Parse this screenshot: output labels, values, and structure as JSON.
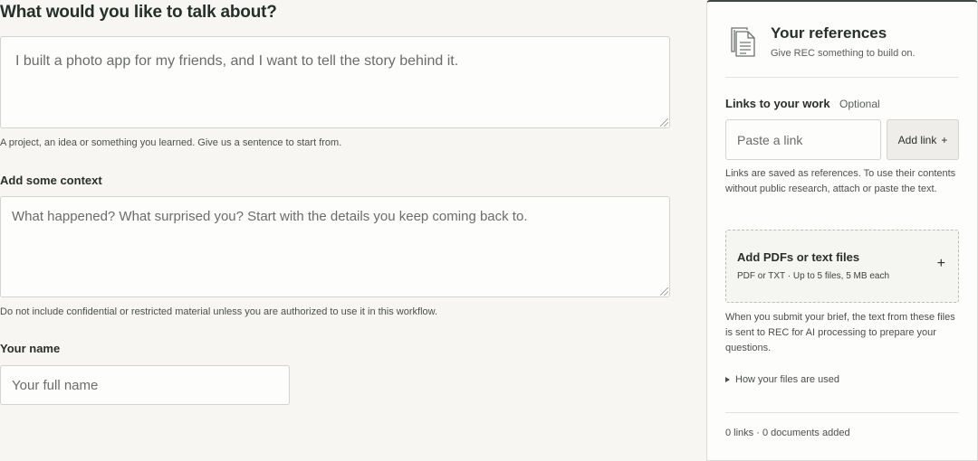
{
  "form": {
    "topic_title": "What would you like to talk about?",
    "topic_placeholder": "I built a photo app for my friends, and I want to tell the story behind it.",
    "topic_hint": "A project, an idea or something you learned. Give us a sentence to start from.",
    "context_label": "Add some context",
    "context_placeholder": "What happened? What surprised you? Start with the details you keep coming back to.",
    "context_hint": "Do not include confidential or restricted material unless you are authorized to use it in this workflow.",
    "name_label": "Your name",
    "name_placeholder": "Your full name"
  },
  "references": {
    "icon": "document-icon",
    "title": "Your references",
    "subtitle": "Give REC something to build on.",
    "links_label": "Links to your work",
    "optional_label": "Optional",
    "link_placeholder": "Paste a link",
    "add_link_label": "Add link",
    "add_link_icon": "+",
    "links_note": "Links are saved as references. To use their contents without public research, attach or paste the text.",
    "upload_title": "Add PDFs or text files",
    "upload_sub": "PDF or TXT · Up to 5 files, 5 MB each",
    "upload_icon": "+",
    "submit_note": "When you submit your brief, the text from these files is sent to REC for AI processing to prepare your questions.",
    "files_details_label": "How your files are used",
    "counts": "0 links · 0 documents added"
  },
  "colors": {
    "background": "#f7f6f3",
    "panel_accent": "#3d4a43",
    "text": "#2b2f2c"
  }
}
